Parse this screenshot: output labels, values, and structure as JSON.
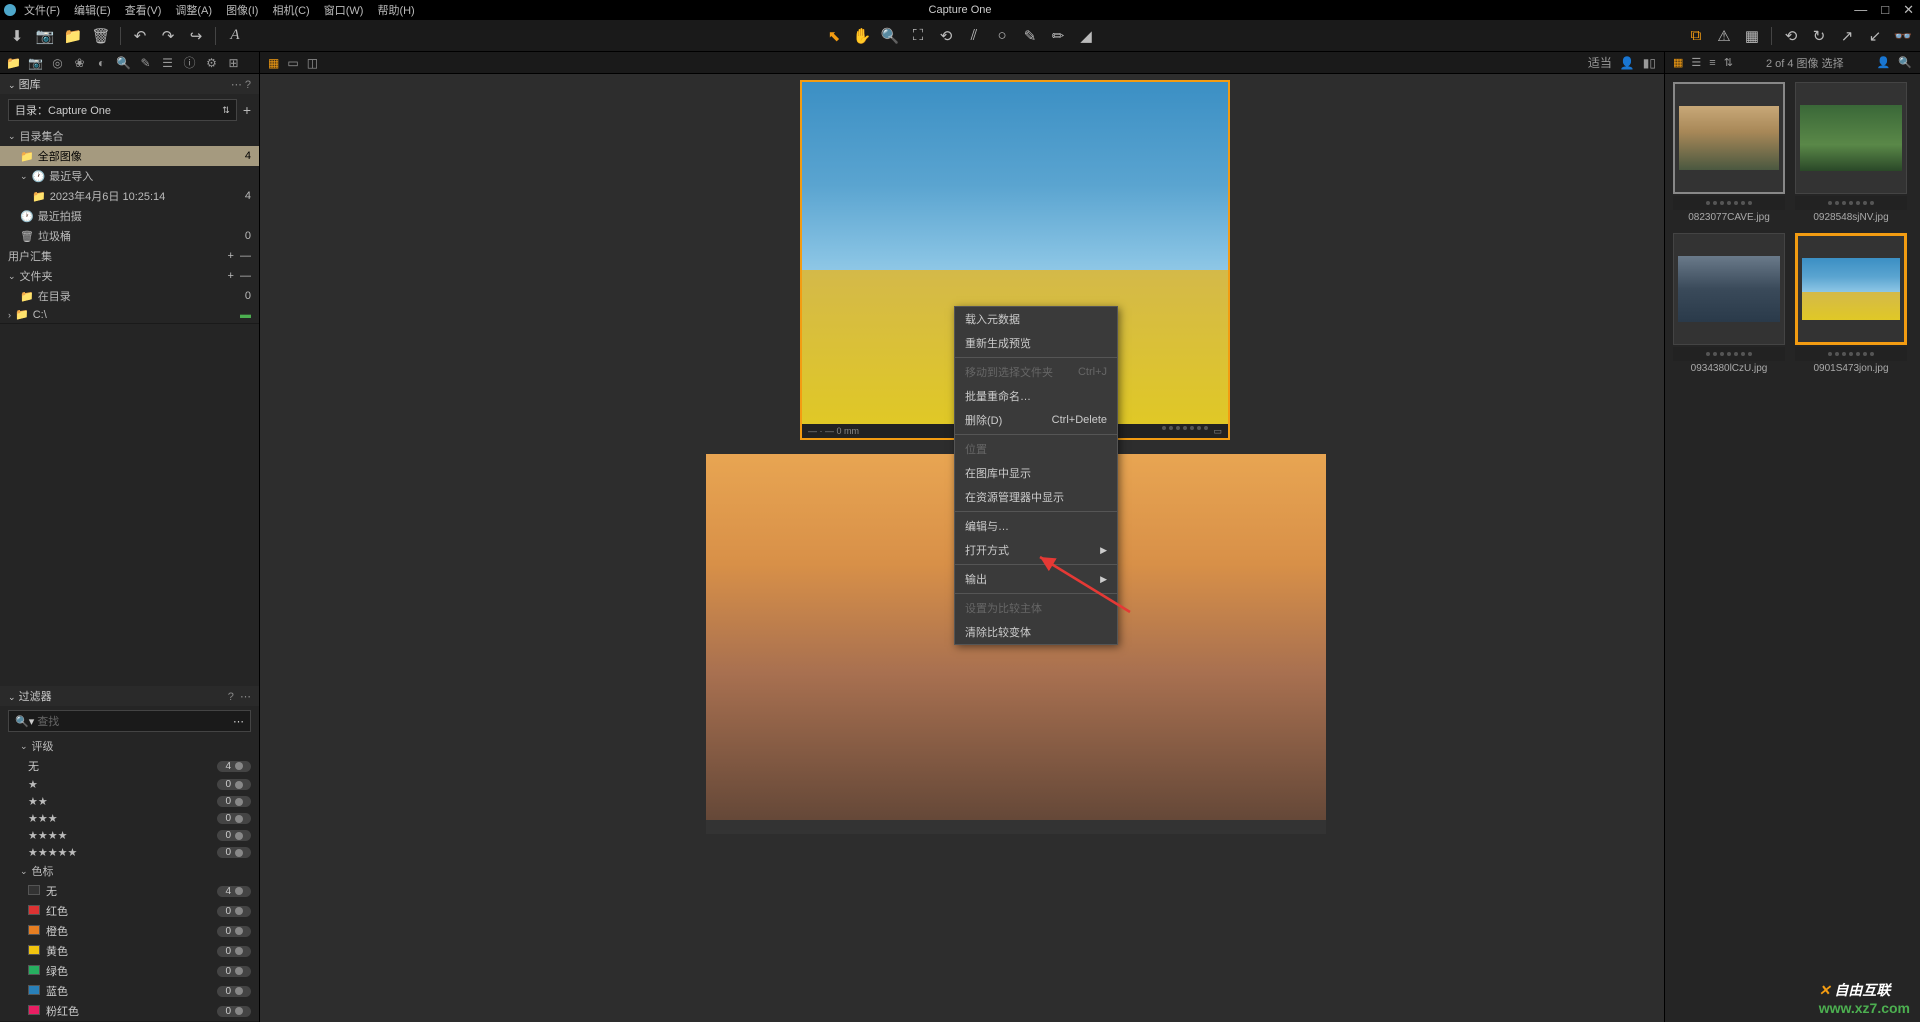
{
  "title": "Capture One",
  "menu": {
    "file": "文件(F)",
    "edit": "编辑(E)",
    "view": "查看(V)",
    "adjust": "调整(A)",
    "image": "图像(I)",
    "camera": "相机(C)",
    "window": "窗口(W)",
    "help": "帮助(H)"
  },
  "catalog": {
    "label": "目录：Capture One"
  },
  "library": {
    "title": "图库",
    "collections_header": "目录集合",
    "all_images": "全部图像",
    "all_images_count": "4",
    "recent_import": "最近导入",
    "recent_import_date": "2023年4月6日 10:25:14",
    "recent_import_count": "4",
    "recent_capture": "最近拍摄",
    "trash": "垃圾桶",
    "trash_count": "0",
    "user_collections": "用户汇集",
    "folders_header": "文件夹",
    "in_catalog": "在目录",
    "in_catalog_count": "0",
    "drive": "C:\\"
  },
  "filter": {
    "title": "过滤器",
    "search_placeholder": "查找",
    "rating_header": "评级",
    "rating_none": "无",
    "rating_none_count": "4",
    "color_header": "色标",
    "color_none": "无",
    "color_none_count": "4",
    "red": "红色",
    "orange": "橙色",
    "yellow": "黄色",
    "green": "绿色",
    "blue": "蓝色",
    "pink": "粉红色",
    "zero": "0"
  },
  "viewer": {
    "fit_label": "适当",
    "count_label": "2 of 4 图像 选择",
    "ruler": "— · — 0 mm"
  },
  "context": {
    "load_metadata": "载入元数据",
    "regenerate_preview": "重新生成预览",
    "move_to_selects": "移动到选择文件夹",
    "move_to_selects_sc": "Ctrl+J",
    "batch_rename": "批量重命名…",
    "delete": "删除(D)",
    "delete_sc": "Ctrl+Delete",
    "position": "位置",
    "show_in_library": "在图库中显示",
    "show_in_explorer": "在资源管理器中显示",
    "edit_with": "编辑与…",
    "open_with": "打开方式",
    "export": "输出",
    "set_compare_main": "设置为比较主体",
    "clear_compare": "清除比较变体"
  },
  "thumbnails": {
    "t1": "0823077CAVE.jpg",
    "t2": "0928548sjNV.jpg",
    "t3": "0934380lCzU.jpg",
    "t4": "0901S473jon.jpg"
  },
  "watermark": {
    "line1": "自由互联",
    "line2": "www.xz7.com"
  }
}
